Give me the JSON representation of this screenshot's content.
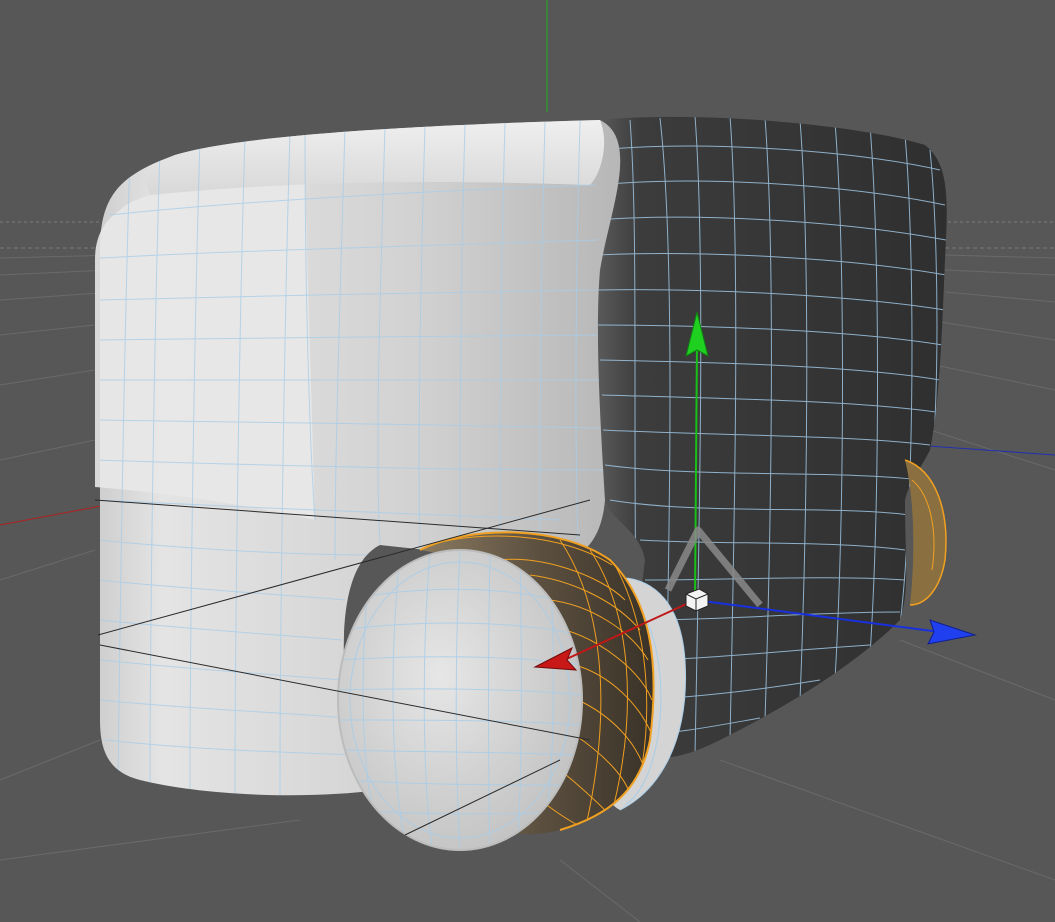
{
  "viewport": {
    "view": "perspective",
    "background_color": "#575757",
    "grid_color": "#6a6a6a",
    "horizon_dashed": true
  },
  "object": {
    "type": "subdivision mesh",
    "shape": "rounded box with wheel hubs",
    "surface_color": "#d9d9d9",
    "shadow_color": "#3a3a3a",
    "wire_color": "#a8cce8",
    "selected_edge_color": "#f0a020"
  },
  "gizmo": {
    "x_axis_color": "#c01818",
    "y_axis_color": "#18c018",
    "z_axis_color": "#1830e0",
    "icons": [
      "move-arrow-x-icon",
      "move-arrow-y-icon",
      "move-arrow-z-icon",
      "plane-handle-icon",
      "object-center-icon"
    ]
  }
}
